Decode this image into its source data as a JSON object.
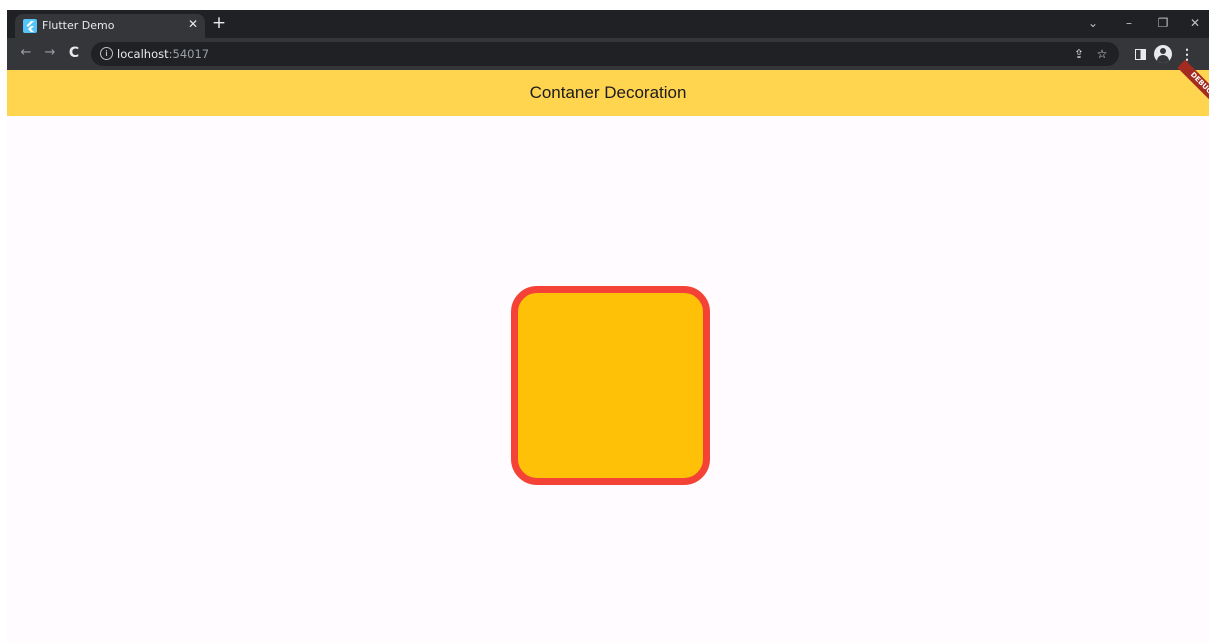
{
  "browser": {
    "tab": {
      "title": "Flutter Demo",
      "close_icon": "close-icon",
      "favicon": "flutter-logo-icon"
    },
    "new_tab_icon": "plus-icon",
    "window_controls": {
      "tab_search": "⌄",
      "minimize": "–",
      "restore": "❐",
      "close": "✕"
    },
    "nav": {
      "back": "←",
      "forward": "→",
      "reload": "C"
    },
    "address_bar": {
      "host": "localhost",
      "port": ":54017"
    },
    "toolbar_icons": {
      "share": "⇪",
      "bookmark": "☆",
      "more": "⋮"
    }
  },
  "app": {
    "title": "Contaner Decoration",
    "debug_banner": "DEBUG",
    "colors": {
      "appbar": "#ffd54f",
      "background": "#fffbfe",
      "box_fill": "#ffc107",
      "box_border": "#f44336"
    }
  }
}
